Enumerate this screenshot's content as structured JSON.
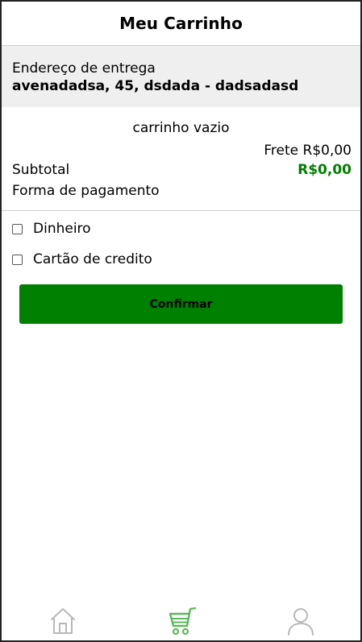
{
  "header": {
    "title": "Meu Carrinho"
  },
  "address": {
    "label": "Endereço de entrega",
    "value": "avenadadsa, 45, dsdada - dadsadasd"
  },
  "cart": {
    "empty_text": "carrinho vazio",
    "frete_text": "Frete R$0,00",
    "subtotal_label": "Subtotal",
    "subtotal_value": "R$0,00"
  },
  "payment": {
    "title": "Forma de pagamento",
    "options": [
      {
        "label": "Dinheiro",
        "checked": false
      },
      {
        "label": "Cartão de credito",
        "checked": false
      }
    ],
    "confirm_label": "Confirmar"
  },
  "bottom_nav": {
    "items": [
      {
        "icon": "home-icon",
        "active": false
      },
      {
        "icon": "cart-icon",
        "active": true
      },
      {
        "icon": "user-icon",
        "active": false
      }
    ],
    "active_color": "#5cb85c",
    "inactive_color": "#b8b8b8"
  },
  "colors": {
    "accent": "#008000",
    "address_background": "#efefef"
  }
}
